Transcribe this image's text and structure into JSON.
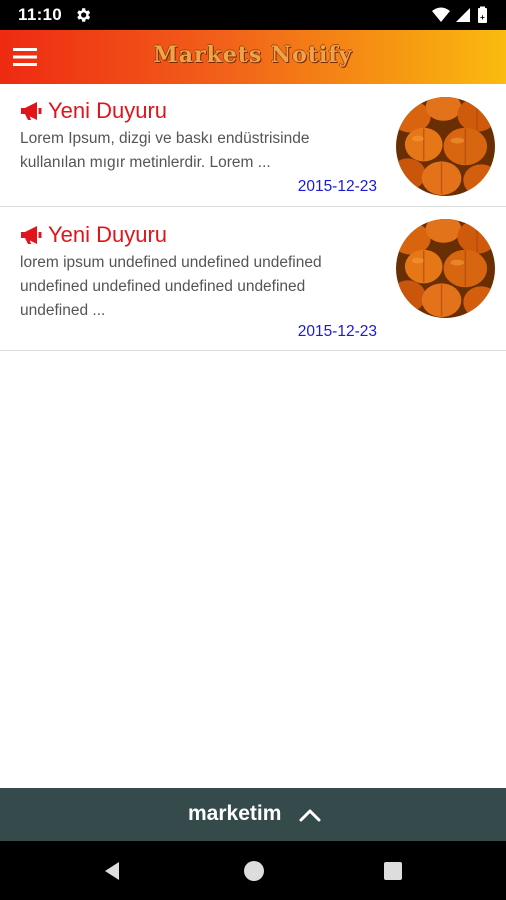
{
  "status_bar": {
    "time": "11:10",
    "icons": [
      "settings-gear-icon",
      "wifi-icon",
      "signal-icon",
      "battery-icon"
    ]
  },
  "app_bar": {
    "title": "Markets Notify",
    "menu_icon": "hamburger-menu-icon"
  },
  "notifications": [
    {
      "title": "Yeni Duyuru",
      "body": "Lorem Ipsum, dizgi ve baskı endüstrisinde kullanılan mıgır metinlerdir. Lorem ...",
      "date": "2015-12-23",
      "icon": "megaphone-icon",
      "thumbnail": "pumpkins-image"
    },
    {
      "title": "Yeni Duyuru",
      "body": "lorem ipsum undefined undefined undefined undefined undefined undefined undefined undefined ...",
      "date": "2015-12-23",
      "icon": "megaphone-icon",
      "thumbnail": "pumpkins-image"
    }
  ],
  "bottom_bar": {
    "label": "marketim",
    "icon": "chevron-up-icon"
  },
  "nav_bar": {
    "buttons": [
      "back-icon",
      "home-icon",
      "recents-icon"
    ]
  },
  "colors": {
    "app_bar_start": "#ee2a12",
    "app_bar_end": "#fbbb10",
    "title_red": "#e2141b",
    "date_blue": "#1a1ad8",
    "bottom_bar": "#354b4b"
  }
}
